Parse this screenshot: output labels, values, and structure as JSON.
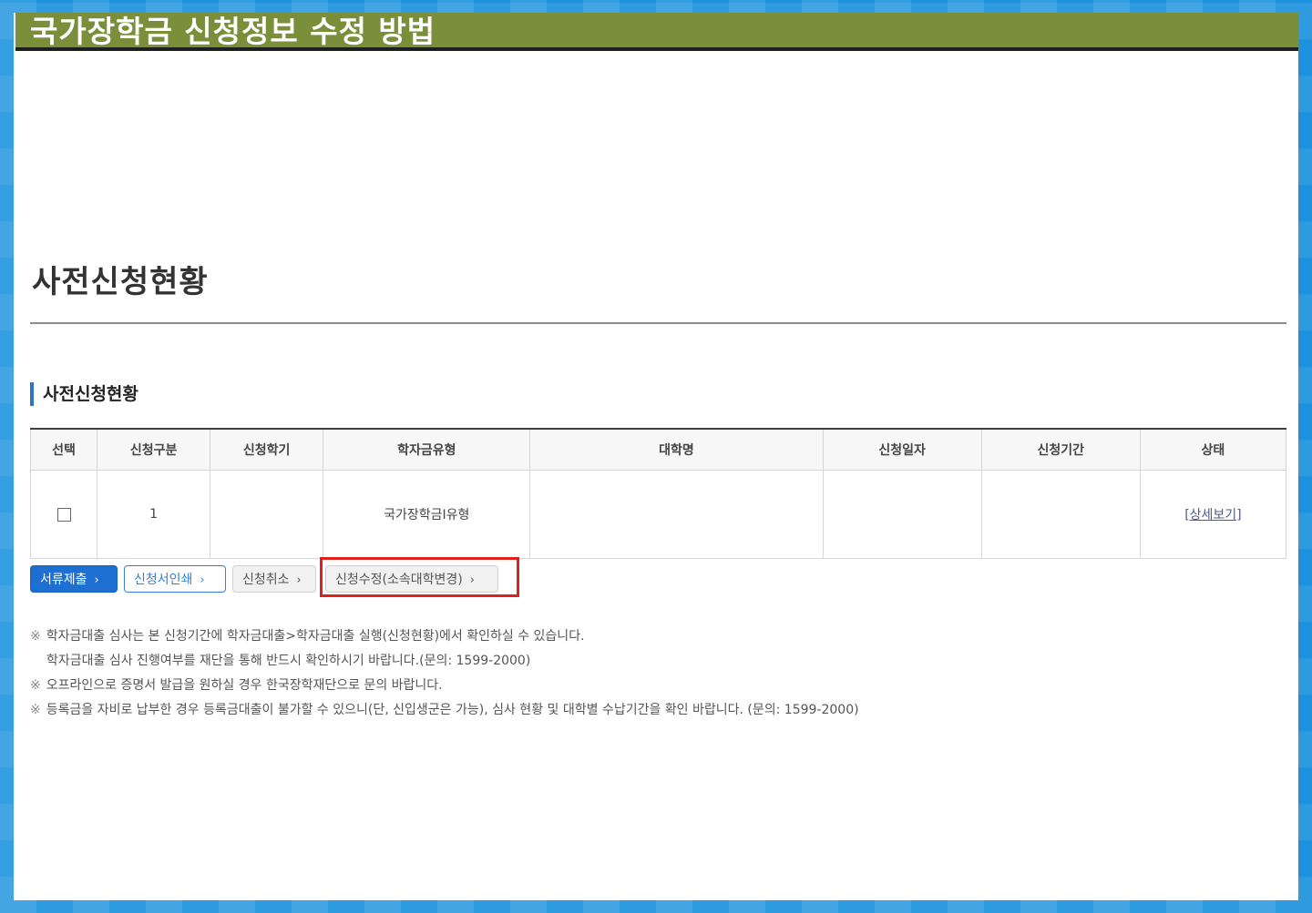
{
  "banner": {
    "title": "국가장학금 신청정보 수정 방법"
  },
  "page": {
    "heading": "사전신청현황"
  },
  "section": {
    "title": "사전신청현황"
  },
  "table": {
    "headers": [
      "선택",
      "신청구분",
      "신청학기",
      "학자금유형",
      "대학명",
      "신청일자",
      "신청기간",
      "상태"
    ],
    "rows": [
      {
        "select": "",
        "category": "1",
        "semester": "",
        "type": "국가장학금I유형",
        "university": "",
        "date": "",
        "period": "",
        "status": "[상세보기]"
      }
    ]
  },
  "buttons": {
    "submit": "서류제출",
    "print": "신청서인쇄",
    "cancel": "신청취소",
    "modify": "신청수정(소속대학변경)",
    "chevron": "›"
  },
  "notes": {
    "mark": "※",
    "line1": "학자금대출 심사는 본 신청기간에 학자금대출>학자금대출 실행(신청현황)에서 확인하실 수 있습니다.",
    "line2": "학자금대출 심사 진행여부를 재단을 통해 반드시 확인하시기 바랍니다.(문의: 1599-2000)",
    "line3": "오프라인으로 증명서 발급을 원하실 경우 한국장학재단으로 문의 바랍니다.",
    "line4": "등록금을 자비로 납부한 경우 등록금대출이 불가할 수 있으니(단, 신입생군은 가능), 심사 현황 및 대학별 수납기간을 확인 바랍니다. (문의: 1599-2000)"
  },
  "colors": {
    "banner": "#7b8f3a",
    "primary": "#1d6fd1",
    "highlight": "#e0201c",
    "frame": "#1c93dc"
  }
}
